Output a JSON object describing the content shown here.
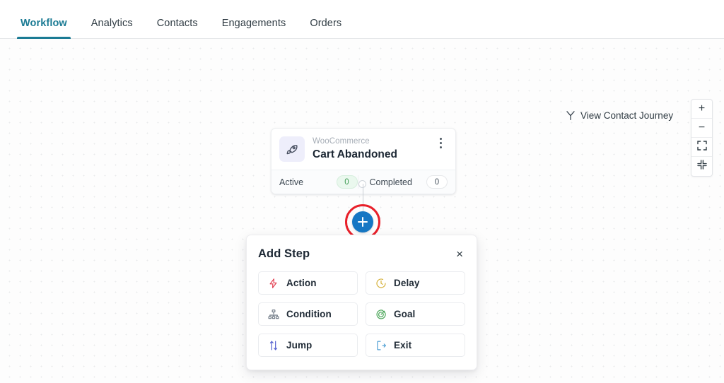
{
  "tabs": [
    {
      "label": "Workflow",
      "active": true
    },
    {
      "label": "Analytics",
      "active": false
    },
    {
      "label": "Contacts",
      "active": false
    },
    {
      "label": "Engagements",
      "active": false
    },
    {
      "label": "Orders",
      "active": false
    }
  ],
  "canvas": {
    "view_journey_label": "View Contact Journey",
    "zoom_controls": [
      {
        "name": "zoom-in",
        "glyph": "+"
      },
      {
        "name": "zoom-out",
        "glyph": "−"
      },
      {
        "name": "fit-to-screen",
        "glyph": ""
      },
      {
        "name": "collapse-view",
        "glyph": ""
      }
    ]
  },
  "trigger_node": {
    "icon": "rocket-icon",
    "source": "WooCommerce",
    "title": "Cart Abandoned",
    "menu_icon": "more-vertical-icon",
    "stats": [
      {
        "label": "Active",
        "value": "0",
        "style": "green"
      },
      {
        "label": "Completed",
        "value": "0",
        "style": "plain"
      }
    ]
  },
  "add_node": {
    "icon": "plus-icon",
    "highlight_color": "#e8202a"
  },
  "panel": {
    "title": "Add Step",
    "close_label": "×",
    "options": [
      {
        "label": "Action",
        "icon": "lightning-bolt-icon",
        "color": "#e23c4e"
      },
      {
        "label": "Delay",
        "icon": "clock-icon",
        "color": "#d6b23c"
      },
      {
        "label": "Condition",
        "icon": "hierarchy-icon",
        "color": "#6b7682"
      },
      {
        "label": "Goal",
        "icon": "target-icon",
        "color": "#4aa558"
      },
      {
        "label": "Jump",
        "icon": "jump-arrows-icon",
        "color": "#5460cf"
      },
      {
        "label": "Exit",
        "icon": "exit-door-icon",
        "color": "#4f9fd4"
      }
    ]
  },
  "theme": {
    "accent": "#1b7b94",
    "node_blue": "#1677c4",
    "annotation_red": "#e8202a"
  }
}
